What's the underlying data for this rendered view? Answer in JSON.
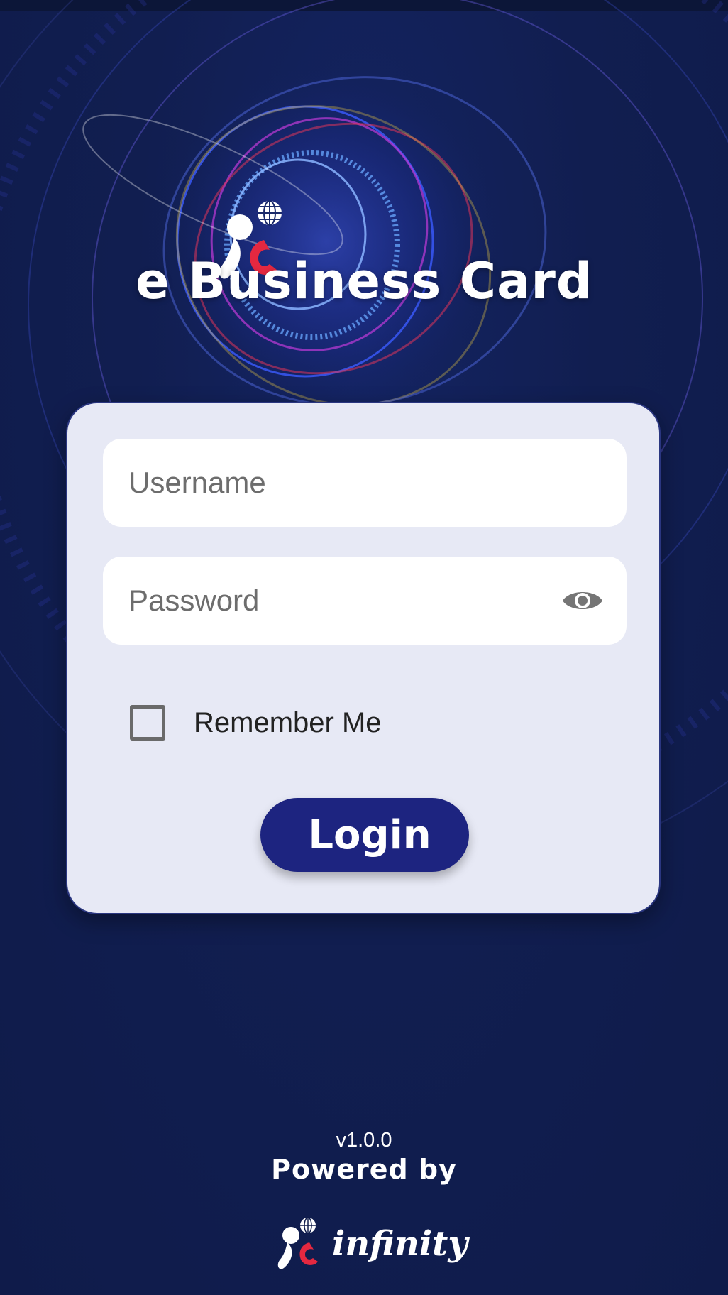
{
  "app": {
    "title": "e Business Card",
    "logo_icon": "ebc-logo-icon"
  },
  "login": {
    "username_placeholder": "Username",
    "username_value": "",
    "password_placeholder": "Password",
    "password_value": "",
    "show_password_icon": "eye-icon",
    "remember_label": "Remember Me",
    "remember_checked": false,
    "button_label": "Login"
  },
  "footer": {
    "version": "v1.0.0",
    "powered_by": "Powered by",
    "brand_name": "infinity"
  },
  "colors": {
    "background": "#101d4c",
    "card": "#e7e9f5",
    "button": "#1d2480",
    "logo_red": "#e52840"
  }
}
